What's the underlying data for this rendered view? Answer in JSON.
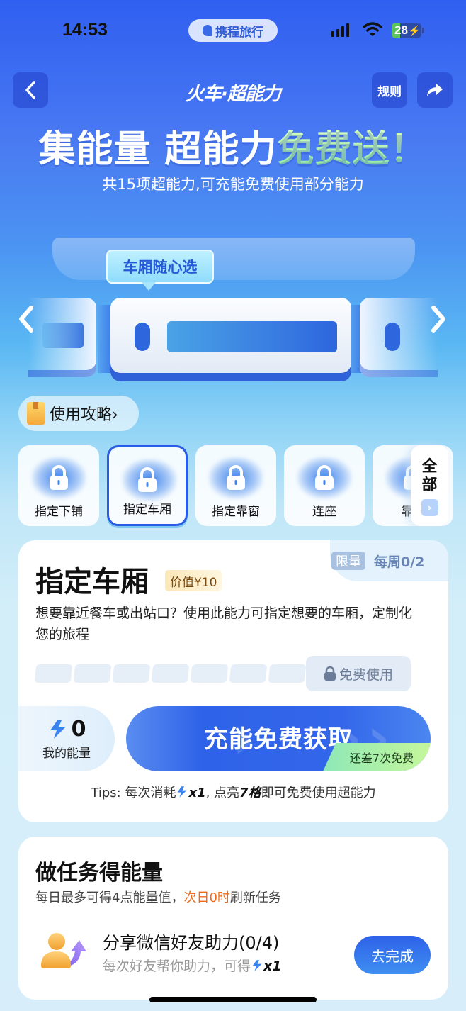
{
  "status_bar": {
    "time": "14:53",
    "brand": "携程旅行",
    "battery": "28"
  },
  "nav": {
    "title": "火车·超能力",
    "rules_label": "规则",
    "back_icon": "chevron-left-icon",
    "share_icon": "share-arrow-icon"
  },
  "hero": {
    "title_white": "集能量 超能力",
    "title_green": "免费送！",
    "subtitle": "共15项超能力,可充能免费使用部分能力"
  },
  "banner": {
    "bubble_text": "车厢随心选",
    "prev_icon": "chevron-left-icon",
    "next_icon": "chevron-right-icon"
  },
  "guide": {
    "label": "使用攻略›"
  },
  "abilities": {
    "items": [
      {
        "label": "指定下铺",
        "locked": true,
        "selected": false
      },
      {
        "label": "指定车厢",
        "locked": true,
        "selected": true
      },
      {
        "label": "指定靠窗",
        "locked": true,
        "selected": false
      },
      {
        "label": "连座",
        "locked": true,
        "selected": false
      },
      {
        "label": "靠过",
        "locked": true,
        "selected": false
      }
    ],
    "more_label_1": "全",
    "more_label_2": "部"
  },
  "ability_card": {
    "limit_badge": "限量",
    "limit_text": "每周0/2",
    "title": "指定车厢",
    "value_badge": "价值¥10",
    "description": "想要靠近餐车或出站口？使用此能力可指定想要的车厢，定制化您的旅程",
    "progress": {
      "lit": 0,
      "total": 7
    },
    "free_use_label": "免费使用",
    "energy_value": "0",
    "energy_label": "我的能量",
    "charge_label": "充能免费获取",
    "charge_tag": "还差7次免费",
    "tips_prefix": "Tips: 每次消耗",
    "tips_cost": "x1",
    "tips_mid": ", 点亮",
    "tips_count": "7格",
    "tips_suffix": "即可免费使用超能力"
  },
  "tasks": {
    "title": "做任务得能量",
    "subtitle_prefix": "每日最多可得4点能量值，",
    "subtitle_highlight": "次日0时",
    "subtitle_suffix": "刷新任务",
    "items": [
      {
        "name": "分享微信好友助力(0/4)",
        "desc_prefix": "每次好友帮你助力，可得",
        "desc_reward": "x1",
        "button": "去完成"
      }
    ]
  },
  "colors": {
    "brand_blue": "#2e62e8",
    "highlight_orange": "#f06a1b",
    "accent_green": "#8de8a0"
  }
}
